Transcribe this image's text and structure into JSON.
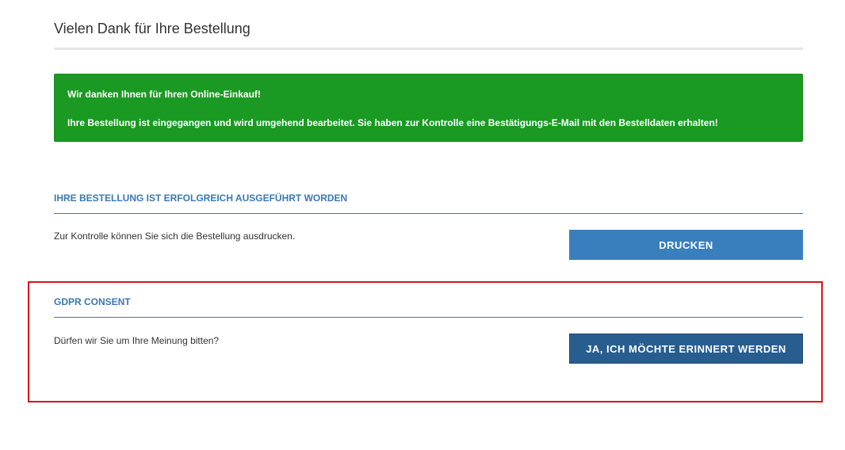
{
  "page": {
    "title": "Vielen Dank für Ihre Bestellung"
  },
  "alert": {
    "line1": "Wir danken Ihnen für Ihren Online-Einkauf!",
    "line2": "Ihre Bestellung ist eingegangen und wird umgehend bearbeitet. Sie haben zur Kontrolle eine Bestätigungs-E-Mail mit den Bestelldaten erhalten!",
    "color": "#1a9a22"
  },
  "order_section": {
    "heading": "IHRE BESTELLUNG IST ERFOLGREICH AUSGEFÜHRT WORDEN",
    "text": "Zur Kontrolle können Sie sich die Bestellung ausdrucken.",
    "button_label": "DRUCKEN"
  },
  "gdpr_section": {
    "heading": "GDPR CONSENT",
    "text": "Dürfen wir Sie um Ihre Meinung bitten?",
    "button_label": "JA, ICH MÖCHTE ERINNERT WERDEN"
  },
  "colors": {
    "accent": "#3a78b6",
    "button_primary": "#3a7fbd",
    "button_dark": "#285d8f",
    "highlight": "#d6151c"
  }
}
